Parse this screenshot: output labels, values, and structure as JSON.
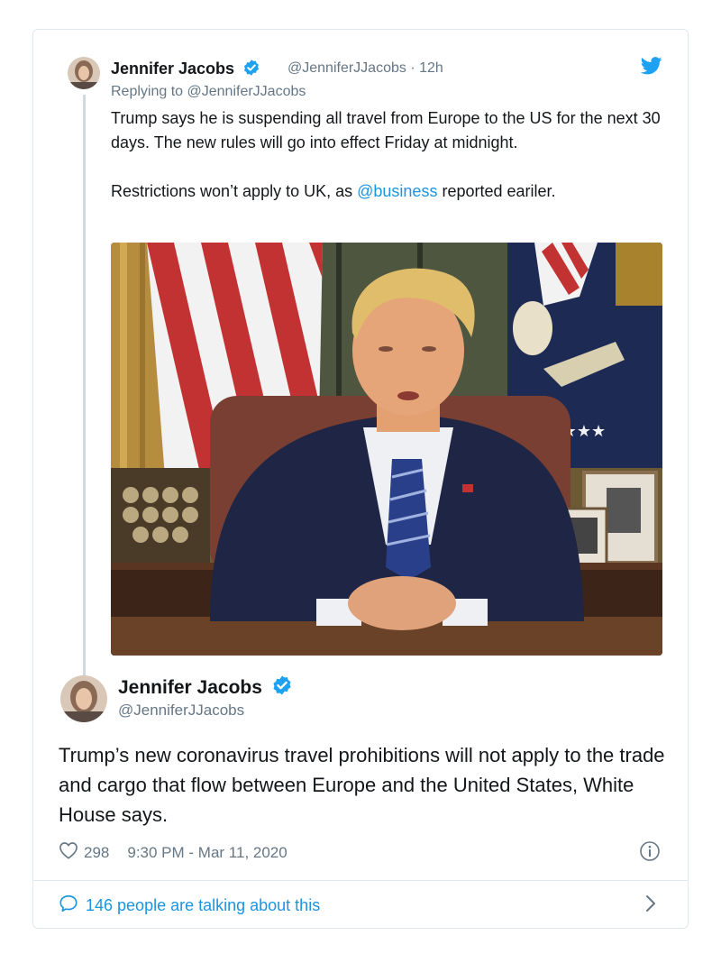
{
  "reply_tweet": {
    "author_name": "Jennifer Jacobs",
    "handle": "@JenniferJJacobs",
    "time": "· 12h",
    "replying_prefix": "Replying to",
    "replying_handle": "@JenniferJJacobs",
    "text_p1": "Trump says he is suspending all travel from Europe to the US for the next 30 days. The new rules will go into effect Friday at midnight.",
    "text_p2_before": "Restrictions won’t apply to UK, as ",
    "text_p2_link": "@business",
    "text_p2_after": " reported eariler."
  },
  "main_tweet": {
    "author_name": "Jennifer Jacobs",
    "handle": "@JenniferJJacobs",
    "text": "Trump’s new coronavirus travel prohibitions will not apply to the trade and cargo that flow between Europe and the United States, White House says.",
    "likes": "298",
    "timestamp": "9:30 PM - Mar 11, 2020"
  },
  "footer": {
    "talking": "146 people are talking about this"
  },
  "icons": {
    "verified": "verified-badge-icon",
    "bird": "twitter-bird-icon",
    "heart": "heart-icon",
    "info": "info-icon",
    "comment": "speech-bubble-icon",
    "chevron": "chevron-right-icon"
  },
  "colors": {
    "accent": "#1b95e0",
    "muted": "#657786",
    "border": "#e1e8ed"
  }
}
